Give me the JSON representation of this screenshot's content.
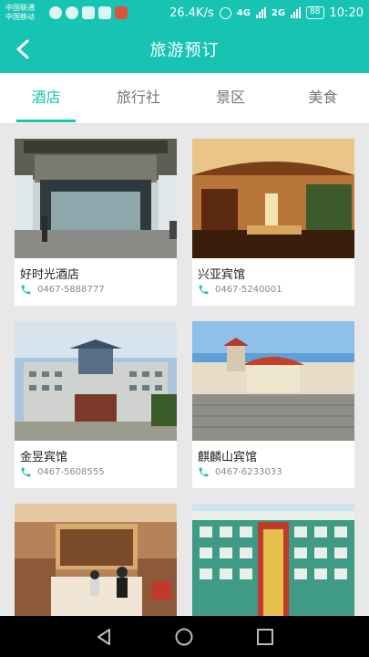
{
  "status": {
    "carrier1": "中国联通",
    "carrier2": "中国移动",
    "speed": "26.4K/s",
    "net1": "4G",
    "net2": "2G",
    "battery": "88",
    "time": "10:20"
  },
  "header": {
    "title": "旅游预订"
  },
  "tabs": [
    {
      "label": "酒店",
      "active": true
    },
    {
      "label": "旅行社",
      "active": false
    },
    {
      "label": "景区",
      "active": false
    },
    {
      "label": "美食",
      "active": false
    }
  ],
  "hotels": [
    {
      "name": "好时光酒店",
      "phone": "0467-5888777"
    },
    {
      "name": "兴亚宾馆",
      "phone": "0467-5240001"
    },
    {
      "name": "金昱宾馆",
      "phone": "0467-5608555"
    },
    {
      "name": "麒麟山宾馆",
      "phone": "0467-6233033"
    },
    {
      "name": "",
      "phone": ""
    },
    {
      "name": "",
      "phone": ""
    }
  ],
  "colors": {
    "accent": "#17c3b2",
    "phone_icon": "#17c3b2"
  }
}
